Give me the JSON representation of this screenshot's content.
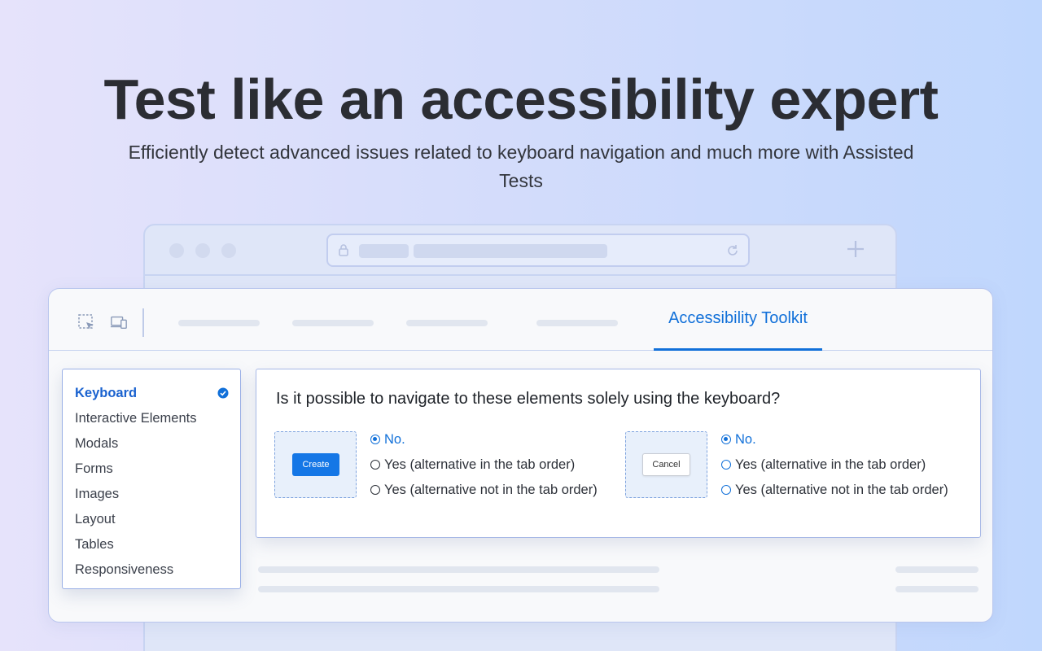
{
  "hero": {
    "title": "Test like an accessibility expert",
    "subtitle": "Efficiently detect advanced issues related to keyboard navigation and much more with Assisted Tests"
  },
  "browser": {
    "icons": [
      "lock-icon",
      "reload-icon",
      "plus-icon"
    ]
  },
  "toolbar": {
    "icons": [
      "select-element-icon",
      "devices-icon"
    ],
    "active_tab": "Accessibility Toolkit"
  },
  "sidebar": {
    "items": [
      {
        "label": "Keyboard",
        "active": true,
        "checked": true
      },
      {
        "label": "Interactive Elements"
      },
      {
        "label": "Modals"
      },
      {
        "label": "Forms"
      },
      {
        "label": "Images"
      },
      {
        "label": "Layout"
      },
      {
        "label": "Tables"
      },
      {
        "label": "Responsiveness"
      }
    ]
  },
  "question": {
    "text": "Is it possible to navigate to these elements solely using the keyboard?",
    "groups": [
      {
        "preview_button": "Create",
        "options": [
          "No.",
          "Yes (alternative in the tab order)",
          "Yes (alternative not in the tab order)"
        ],
        "selected_index": 0
      },
      {
        "preview_button": "Cancel",
        "options": [
          "No.",
          "Yes (alternative in the tab order)",
          "Yes (alternative not in the tab order)"
        ],
        "selected_index": 0
      }
    ]
  },
  "colors": {
    "accent": "#1170d9",
    "primary_button": "#1577e6",
    "heading": "#2b2d33"
  }
}
